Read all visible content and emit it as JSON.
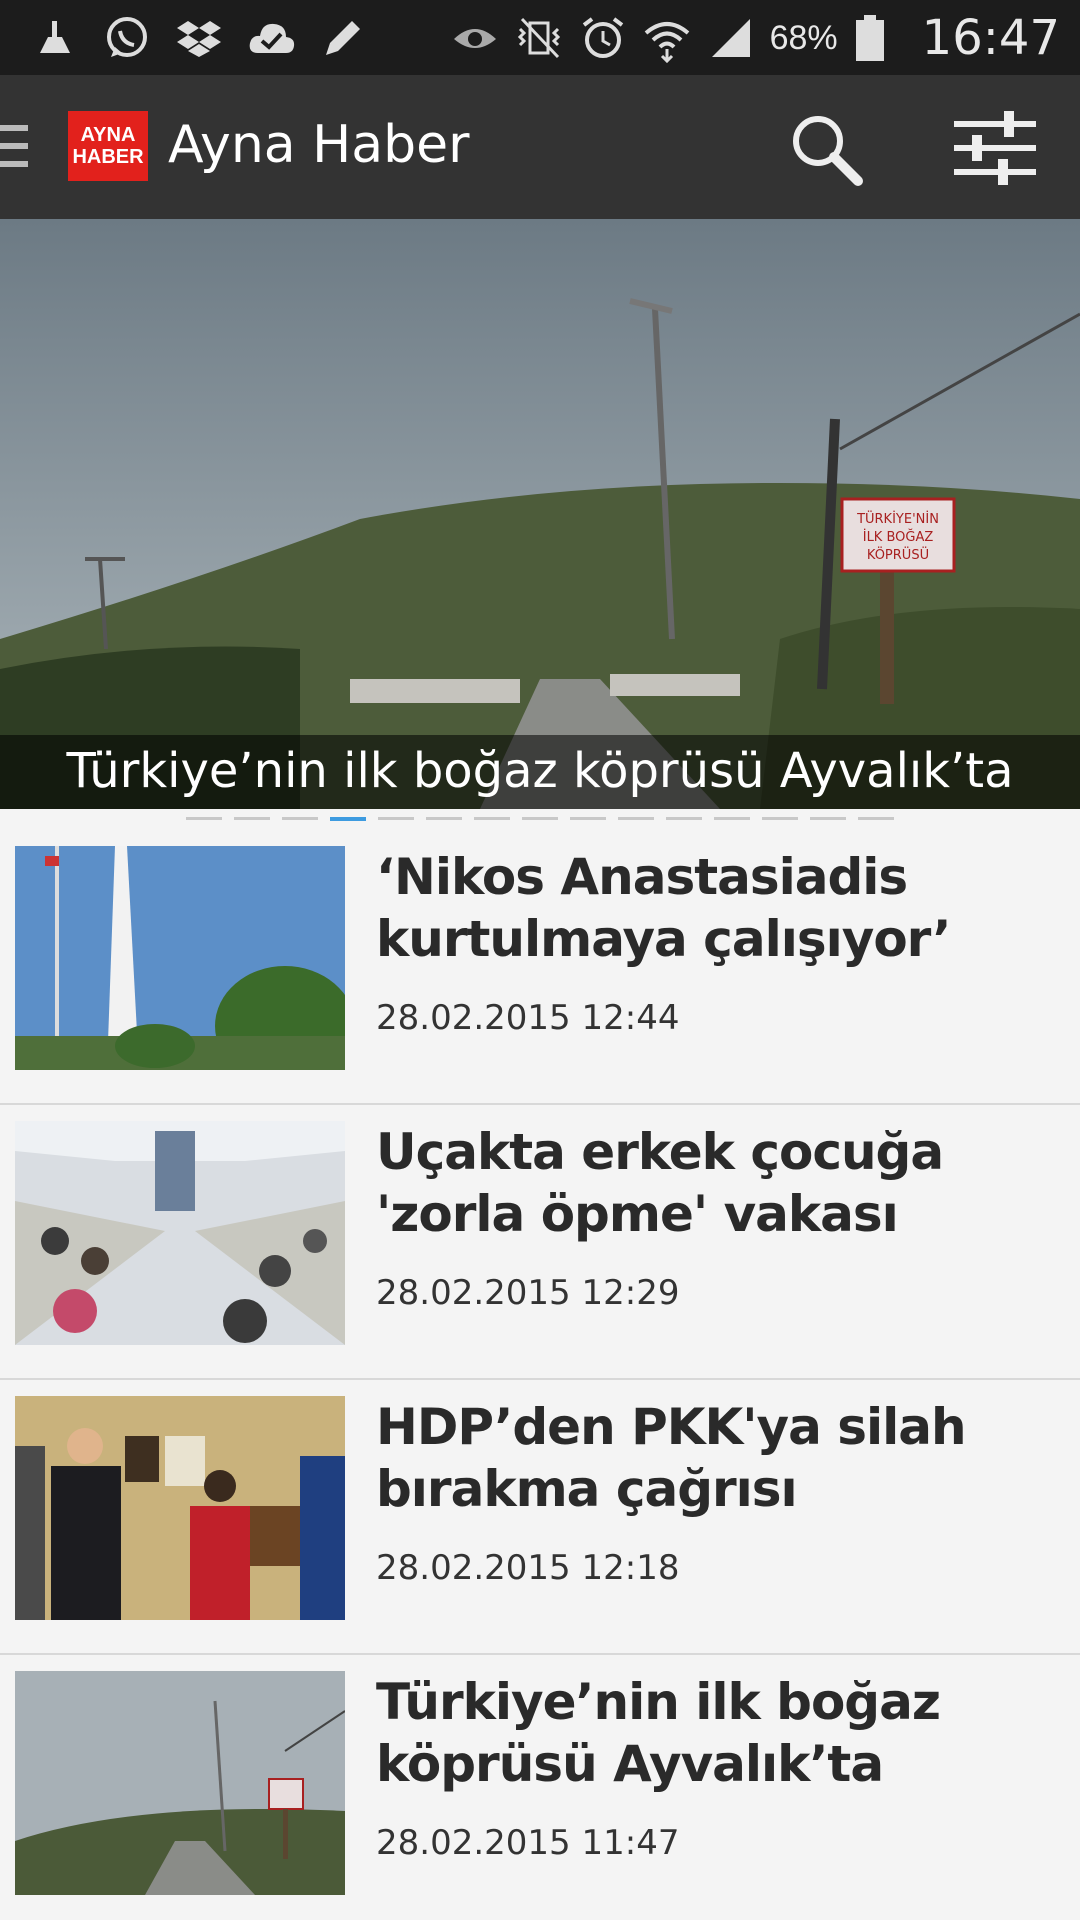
{
  "status_bar": {
    "battery": "68%",
    "time": "16:47",
    "left_icons": [
      "cleaner-icon",
      "whatsapp-icon",
      "dropbox-icon",
      "cloud-check-icon",
      "pen-icon"
    ],
    "right_icons": [
      "eye-icon",
      "vibrate-off-icon",
      "alarm-icon",
      "wifi-icon",
      "signal-icon",
      "battery-icon"
    ]
  },
  "app_bar": {
    "logo_line1": "AYNA",
    "logo_line2": "HABER",
    "title": "Ayna Haber",
    "icons": [
      "drawer-icon",
      "search-icon",
      "filter-icon"
    ]
  },
  "hero": {
    "caption": "Türkiye’nin ilk boğaz köprüsü Ayvalık’ta",
    "sign_line1": "TÜRKİYE'NİN",
    "sign_line2": "İLK BOĞAZ",
    "sign_line3": "KÖPRÜSÜ",
    "pager_count": 15,
    "pager_active": 3
  },
  "news": [
    {
      "title": "‘Nikos Anastasiadis kurtulmaya çalışıyor’",
      "time": "28.02.2015 12:44"
    },
    {
      "title": "Uçakta erkek çocuğa 'zorla öpme' vakası",
      "time": "28.02.2015 12:29"
    },
    {
      "title": "HDP’den PKK'ya silah bırakma çağrısı",
      "time": "28.02.2015 12:18"
    },
    {
      "title": "Türkiye’nin ilk boğaz köprüsü Ayvalık’ta",
      "time": "28.02.2015 11:47"
    }
  ],
  "colors": {
    "app_bar": "#333333",
    "status_bar": "#1c1c1c",
    "logo_red": "#e2211c",
    "pager_active": "#3d9be0"
  }
}
